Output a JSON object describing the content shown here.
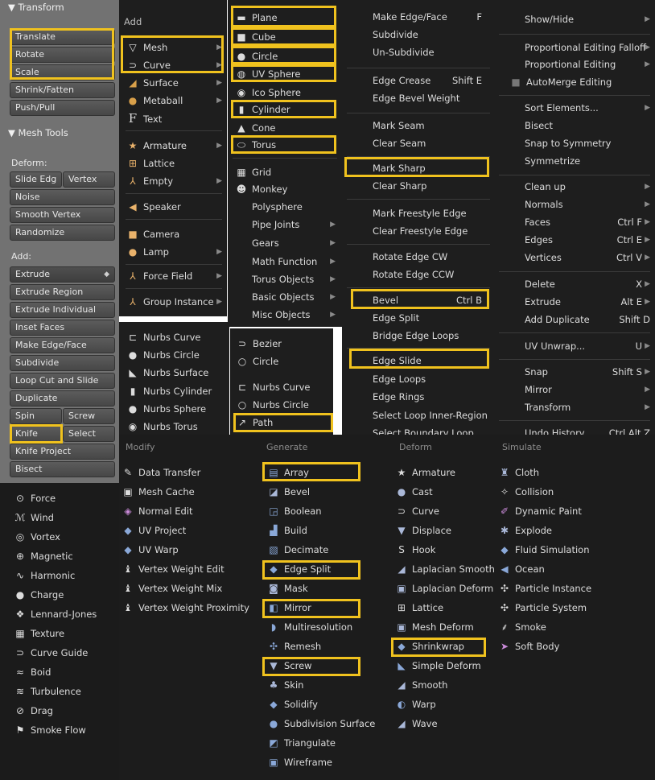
{
  "tool_panel": {
    "transform_header": "▼ Transform",
    "transform_buttons": [
      "Translate",
      "Rotate",
      "Scale",
      "Shrink/Fatten",
      "Push/Pull"
    ],
    "mesh_tools_header": "▼ Mesh Tools",
    "deform_label": "Deform:",
    "slide_edge": "Slide Edg",
    "vertex": "Vertex",
    "noise": "Noise",
    "smooth_vertex": "Smooth Vertex",
    "randomize": "Randomize",
    "add_label": "Add:",
    "extrude": "Extrude",
    "add_buttons": [
      "Extrude Region",
      "Extrude Individual",
      "Inset Faces",
      "Make Edge/Face",
      "Subdivide",
      "Loop Cut and Slide",
      "Duplicate"
    ],
    "spin": "Spin",
    "screw": "Screw",
    "knife": "Knife",
    "select": "Select",
    "knife_project": "Knife Project",
    "bisect": "Bisect"
  },
  "force_fields": [
    "Force",
    "Wind",
    "Vortex",
    "Magnetic",
    "Harmonic",
    "Charge",
    "Lennard-Jones",
    "Texture",
    "Curve Guide",
    "Boid",
    "Turbulence",
    "Drag",
    "Smoke Flow"
  ],
  "add_menu": {
    "header": "Add",
    "items": [
      {
        "label": "Mesh",
        "icon": "mesh-icon",
        "glyph": "▽"
      },
      {
        "label": "Curve",
        "icon": "curve-icon",
        "glyph": "⊃"
      },
      {
        "label": "Surface",
        "icon": "surface-icon",
        "glyph": "◢"
      },
      {
        "label": "Metaball",
        "icon": "metaball-icon",
        "glyph": "●"
      },
      {
        "label": "Text",
        "icon": "text-icon",
        "glyph": "F"
      },
      {
        "label": "Armature",
        "icon": "armature-icon",
        "glyph": "★"
      },
      {
        "label": "Lattice",
        "icon": "lattice-icon",
        "glyph": "⊞"
      },
      {
        "label": "Empty",
        "icon": "empty-icon",
        "glyph": "⅄"
      },
      {
        "label": "Speaker",
        "icon": "speaker-icon",
        "glyph": "◀"
      },
      {
        "label": "Camera",
        "icon": "camera-icon",
        "glyph": "■"
      },
      {
        "label": "Lamp",
        "icon": "lamp-icon",
        "glyph": "●"
      },
      {
        "label": "Force Field",
        "icon": "force-field-icon",
        "glyph": "⅄"
      },
      {
        "label": "Group Instance",
        "icon": "group-instance-icon",
        "glyph": "⅄"
      }
    ]
  },
  "mesh_menu": {
    "primitives": [
      "Plane",
      "Cube",
      "Circle",
      "UV Sphere",
      "Ico Sphere",
      "Cylinder",
      "Cone",
      "Torus"
    ],
    "extras": [
      "Grid",
      "Monkey",
      "Polysphere",
      "Pipe Joints",
      "Gears",
      "Math Function",
      "Torus Objects",
      "Basic Objects",
      "Misc Objects"
    ]
  },
  "surface_menu": [
    "Nurbs Curve",
    "Nurbs Circle",
    "Nurbs Surface",
    "Nurbs Cylinder",
    "Nurbs Sphere",
    "Nurbs Torus"
  ],
  "curve_menu": [
    "Bezier",
    "Circle",
    "Nurbs Curve",
    "Nurbs Circle",
    "Path"
  ],
  "edges_menu": [
    {
      "label": "Make Edge/Face",
      "shortcut": "F"
    },
    {
      "label": "Subdivide",
      "shortcut": ""
    },
    {
      "label": "Un-Subdivide",
      "shortcut": ""
    },
    {
      "label": "Edge Crease",
      "shortcut": "Shift E"
    },
    {
      "label": "Edge Bevel Weight",
      "shortcut": ""
    },
    {
      "label": "Mark Seam",
      "shortcut": ""
    },
    {
      "label": "Clear Seam",
      "shortcut": ""
    },
    {
      "label": "Mark Sharp",
      "shortcut": ""
    },
    {
      "label": "Clear Sharp",
      "shortcut": ""
    },
    {
      "label": "Mark Freestyle Edge",
      "shortcut": ""
    },
    {
      "label": "Clear Freestyle Edge",
      "shortcut": ""
    },
    {
      "label": "Rotate Edge CW",
      "shortcut": ""
    },
    {
      "label": "Rotate Edge CCW",
      "shortcut": ""
    },
    {
      "label": "Bevel",
      "shortcut": "Ctrl B"
    },
    {
      "label": "Edge Split",
      "shortcut": ""
    },
    {
      "label": "Bridge Edge Loops",
      "shortcut": ""
    },
    {
      "label": "Edge Slide",
      "shortcut": ""
    },
    {
      "label": "Edge Loops",
      "shortcut": ""
    },
    {
      "label": "Edge Rings",
      "shortcut": ""
    },
    {
      "label": "Select Loop Inner-Region",
      "shortcut": ""
    },
    {
      "label": "Select Boundary Loop",
      "shortcut": ""
    }
  ],
  "mesh_ops_menu": [
    {
      "label": "Show/Hide",
      "shortcut": ""
    },
    {
      "label": "Proportional Editing Falloff",
      "shortcut": ""
    },
    {
      "label": "Proportional Editing",
      "shortcut": ""
    },
    {
      "label": "AutoMerge Editing",
      "shortcut": ""
    },
    {
      "label": "Sort Elements...",
      "shortcut": ""
    },
    {
      "label": "Bisect",
      "shortcut": ""
    },
    {
      "label": "Snap to Symmetry",
      "shortcut": ""
    },
    {
      "label": "Symmetrize",
      "shortcut": ""
    },
    {
      "label": "Clean up",
      "shortcut": ""
    },
    {
      "label": "Normals",
      "shortcut": ""
    },
    {
      "label": "Faces",
      "shortcut": "Ctrl F"
    },
    {
      "label": "Edges",
      "shortcut": "Ctrl E"
    },
    {
      "label": "Vertices",
      "shortcut": "Ctrl V"
    },
    {
      "label": "Delete",
      "shortcut": "X"
    },
    {
      "label": "Extrude",
      "shortcut": "Alt E"
    },
    {
      "label": "Add Duplicate",
      "shortcut": "Shift D"
    },
    {
      "label": "UV Unwrap...",
      "shortcut": "U"
    },
    {
      "label": "Snap",
      "shortcut": "Shift S"
    },
    {
      "label": "Mirror",
      "shortcut": ""
    },
    {
      "label": "Transform",
      "shortcut": ""
    },
    {
      "label": "Undo History",
      "shortcut": "Ctrl Alt Z"
    }
  ],
  "modifiers": {
    "headers": [
      "Modify",
      "Generate",
      "Deform",
      "Simulate"
    ],
    "modify": [
      "Data Transfer",
      "Mesh Cache",
      "Normal Edit",
      "UV Project",
      "UV Warp",
      "Vertex Weight Edit",
      "Vertex Weight Mix",
      "Vertex Weight Proximity"
    ],
    "generate": [
      "Array",
      "Bevel",
      "Boolean",
      "Build",
      "Decimate",
      "Edge Split",
      "Mask",
      "Mirror",
      "Multiresolution",
      "Remesh",
      "Screw",
      "Skin",
      "Solidify",
      "Subdivision Surface",
      "Triangulate",
      "Wireframe"
    ],
    "deform": [
      "Armature",
      "Cast",
      "Curve",
      "Displace",
      "Hook",
      "Laplacian Smooth",
      "Laplacian Deform",
      "Lattice",
      "Mesh Deform",
      "Shrinkwrap",
      "Simple Deform",
      "Smooth",
      "Warp",
      "Wave"
    ],
    "simulate": [
      "Cloth",
      "Collision",
      "Dynamic Paint",
      "Explode",
      "Fluid Simulation",
      "Ocean",
      "Particle Instance",
      "Particle System",
      "Smoke",
      "Soft Body"
    ]
  },
  "colors": {
    "highlight": "#f0c21e",
    "menu_bg": "#1e1e1e",
    "panel_bg": "#727272"
  }
}
